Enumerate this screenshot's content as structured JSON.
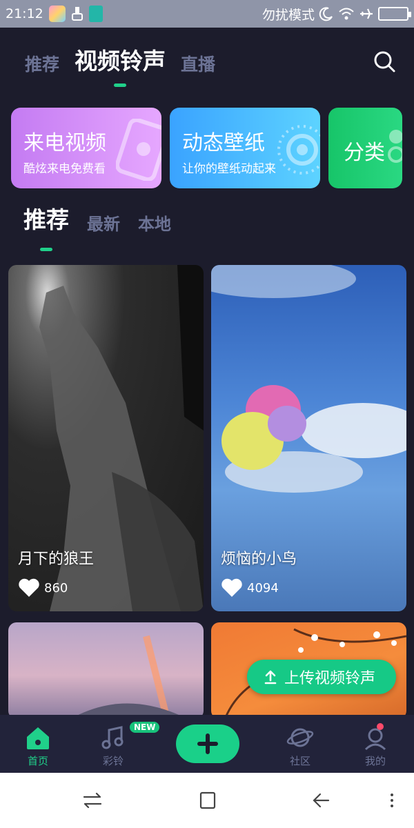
{
  "status_bar": {
    "time": "21:12",
    "dnd_text": "勿扰模式"
  },
  "top_tabs": [
    {
      "label": "推荐"
    },
    {
      "label": "视频铃声"
    },
    {
      "label": "直播"
    }
  ],
  "feature_cards": [
    {
      "title": "来电视频",
      "subtitle": "酷炫来电免费看"
    },
    {
      "title": "动态壁纸",
      "subtitle": "让你的壁纸动起来"
    },
    {
      "title": "分类"
    }
  ],
  "sub_tabs": [
    {
      "label": "推荐"
    },
    {
      "label": "最新"
    },
    {
      "label": "本地"
    }
  ],
  "videos": [
    {
      "title": "月下的狼王",
      "likes": "860"
    },
    {
      "title": "烦恼的小鸟",
      "likes": "4094"
    }
  ],
  "upload": {
    "label": "上传视频铃声"
  },
  "bottom_nav": {
    "home": "首页",
    "ringtone": "彩铃",
    "new_badge": "NEW",
    "community": "社区",
    "me": "我的"
  },
  "colors": {
    "accent": "#20d08a",
    "background": "#1c1c2c",
    "tab_inactive": "#6c7395"
  }
}
